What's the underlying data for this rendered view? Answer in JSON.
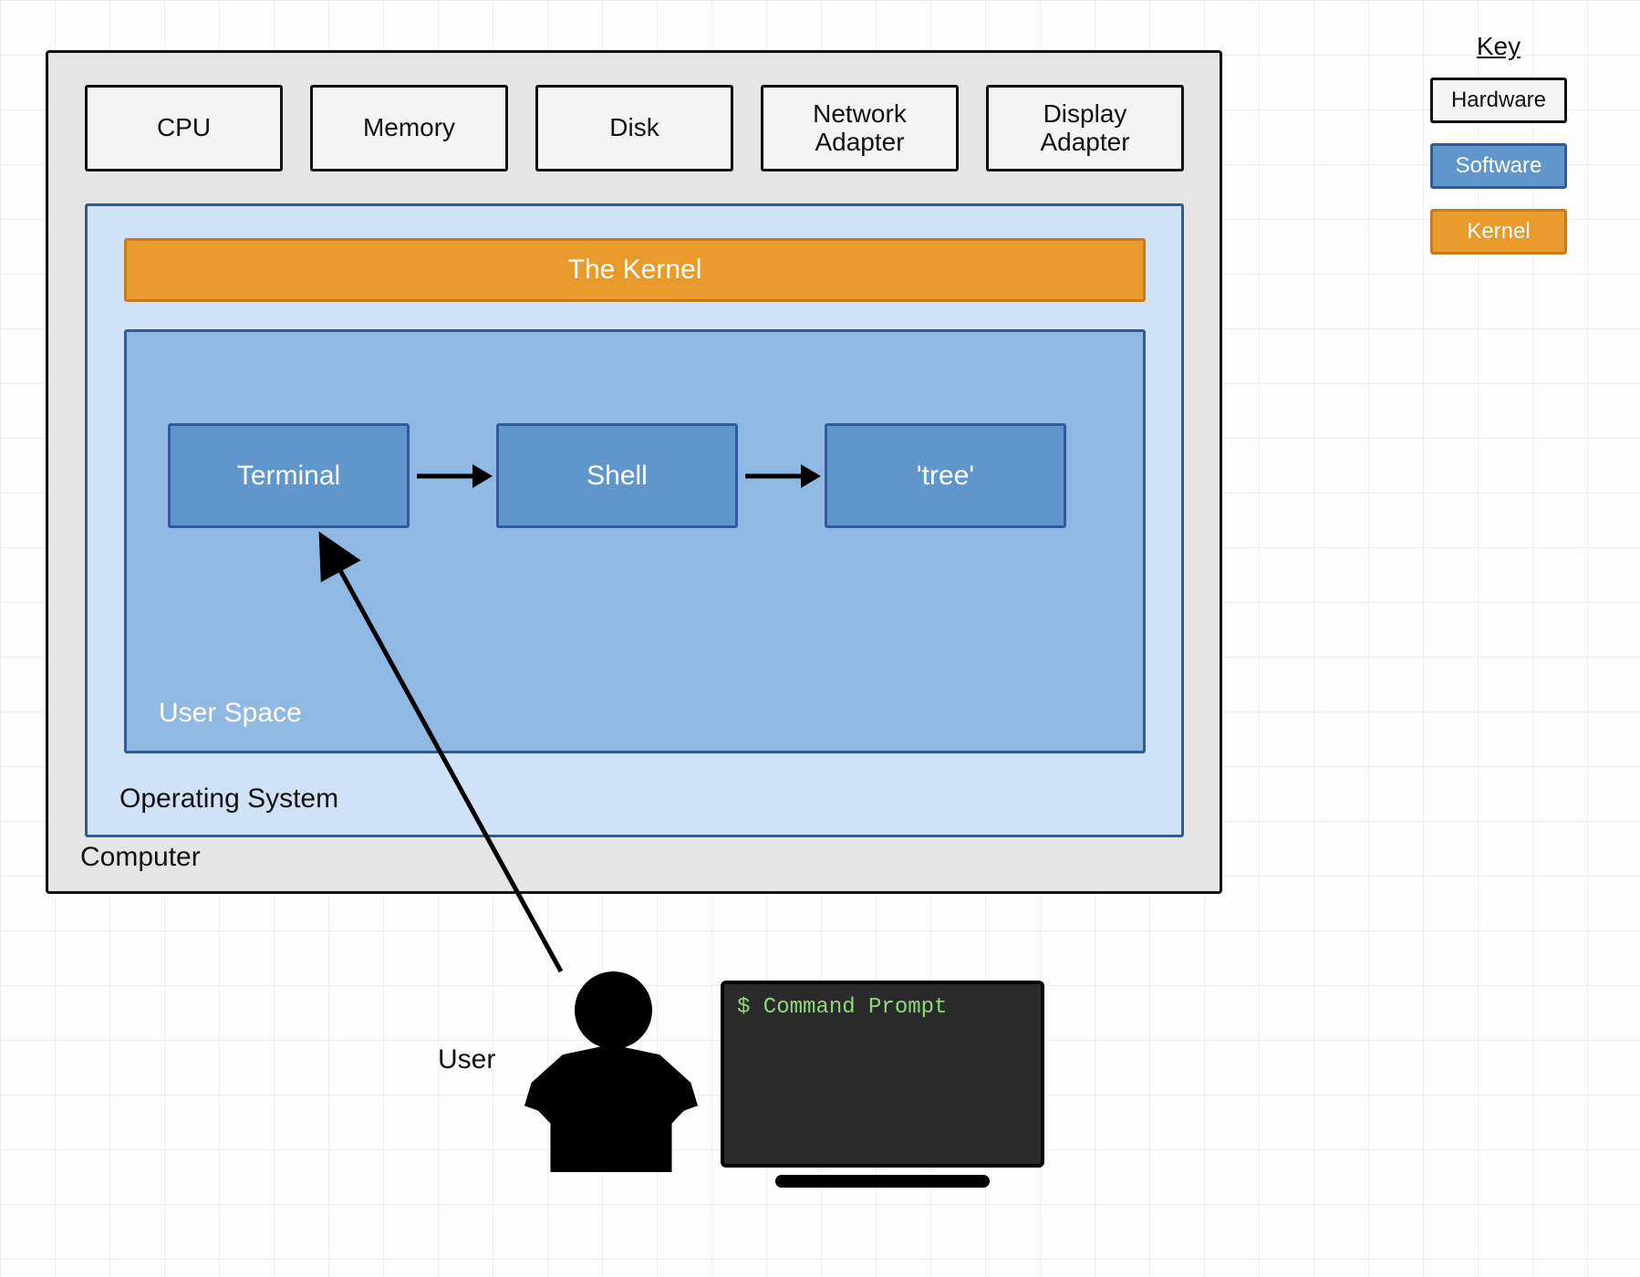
{
  "computer": {
    "label": "Computer",
    "hardware": [
      "CPU",
      "Memory",
      "Disk",
      "Network\nAdapter",
      "Display\nAdapter"
    ],
    "os": {
      "label": "Operating System",
      "kernel": "The Kernel",
      "userspace": {
        "label": "User Space",
        "processes": [
          "Terminal",
          "Shell",
          "'tree'"
        ]
      }
    }
  },
  "legend": {
    "title": "Key",
    "items": [
      {
        "label": "Hardware",
        "cls": "legend-hw"
      },
      {
        "label": "Software",
        "cls": "legend-sw"
      },
      {
        "label": "Kernel",
        "cls": "legend-kn"
      }
    ]
  },
  "user": {
    "label": "User",
    "prompt": "$ Command Prompt"
  },
  "colors": {
    "hardware_bg": "#f4f4f4",
    "software_bg": "#5f97cc",
    "software_border": "#2f5c99",
    "os_bg": "#cfe2f7",
    "kernel_bg": "#e89a2b",
    "kernel_border": "#c97a1a"
  }
}
